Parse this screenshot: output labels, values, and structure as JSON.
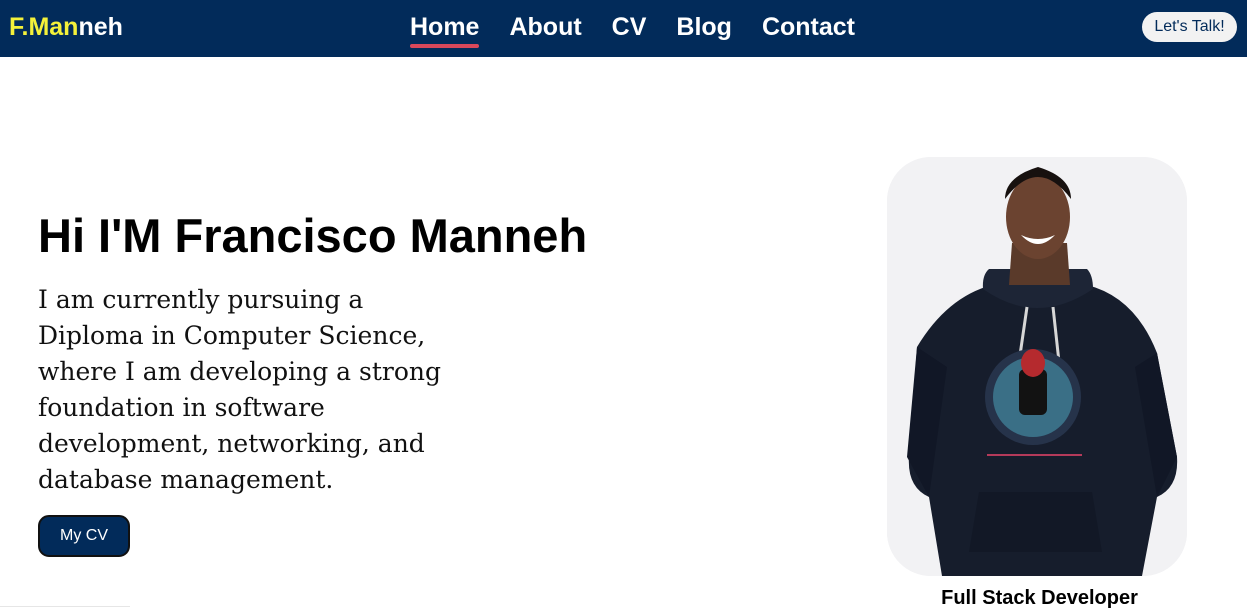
{
  "nav": {
    "logo_accent": "F.Man",
    "logo_rest": "neh",
    "links": [
      "Home",
      "About",
      "CV",
      "Blog",
      "Contact"
    ],
    "active": "Home",
    "cta_label": "Let's Talk!"
  },
  "hero": {
    "title": "Hi I'M Francisco Manneh",
    "description": "I am currently pursuing a Diploma in Computer Science, where I am developing a strong foundation in software development, networking, and database management.",
    "cv_button_label": "My CV"
  },
  "profile": {
    "caption": "Full Stack Developer"
  },
  "colors": {
    "navbar": "#022b5a",
    "logo_accent": "#f4f13a",
    "active_underline": "#d9485a"
  }
}
